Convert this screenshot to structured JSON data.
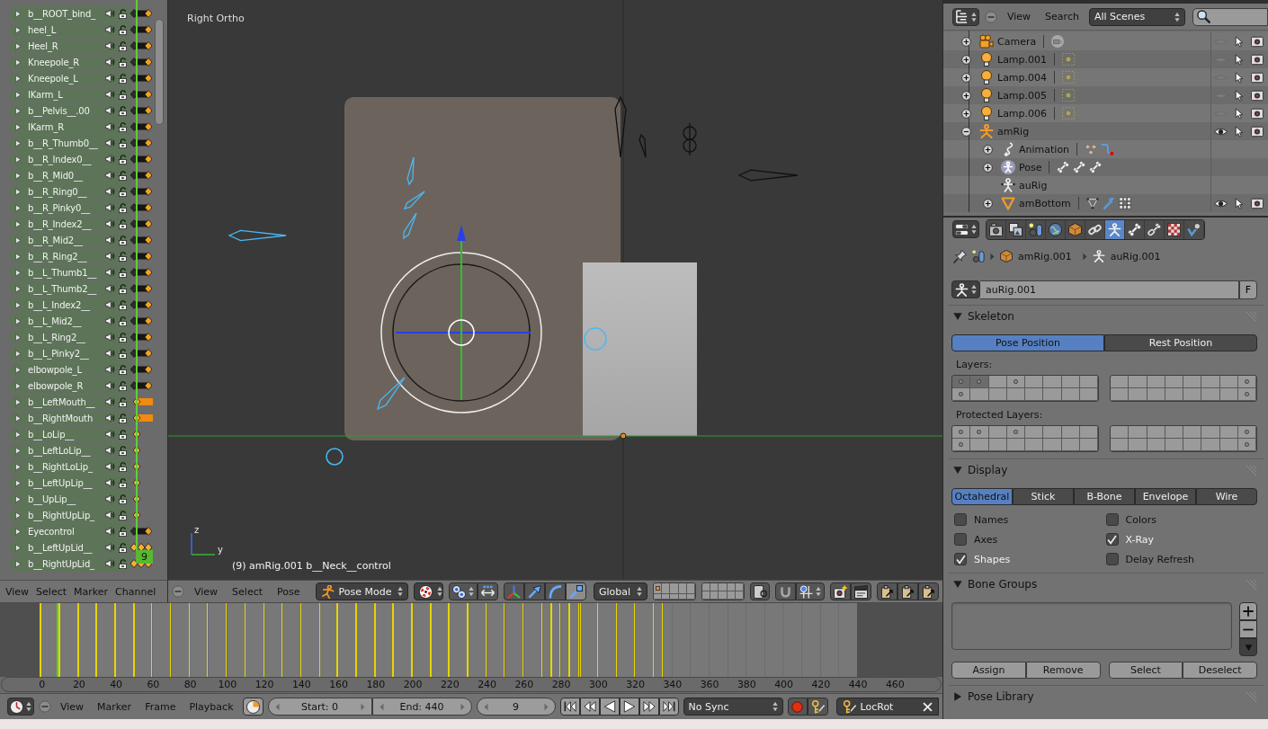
{
  "dopesheet": {
    "channels": [
      {
        "name": "b__ROOT_bind_",
        "kind": "hold"
      },
      {
        "name": "heel_L",
        "kind": "hold"
      },
      {
        "name": "Heel_R",
        "kind": "hold"
      },
      {
        "name": "Kneepole_R",
        "kind": "hold"
      },
      {
        "name": "Kneepole_L",
        "kind": "hold"
      },
      {
        "name": "IKarm_L",
        "kind": "hold"
      },
      {
        "name": "b__Pelvis__.00",
        "kind": "hold"
      },
      {
        "name": "IKarm_R",
        "kind": "hold"
      },
      {
        "name": "b__R_Thumb0__",
        "kind": "hold"
      },
      {
        "name": "b__R_Index0__",
        "kind": "hold"
      },
      {
        "name": "b__R_Mid0__",
        "kind": "hold"
      },
      {
        "name": "b__R_Ring0__",
        "kind": "hold"
      },
      {
        "name": "b__R_Pinky0__",
        "kind": "hold"
      },
      {
        "name": "b__R_Index2__",
        "kind": "hold"
      },
      {
        "name": "b__R_Mid2__",
        "kind": "hold"
      },
      {
        "name": "b__R_Ring2__",
        "kind": "hold"
      },
      {
        "name": "b__L_Thumb1__",
        "kind": "hold"
      },
      {
        "name": "b__L_Thumb2__",
        "kind": "hold"
      },
      {
        "name": "b__L_Index2__",
        "kind": "hold"
      },
      {
        "name": "b__L_Mid2__",
        "kind": "hold"
      },
      {
        "name": "b__L_Ring2__",
        "kind": "hold"
      },
      {
        "name": "b__L_Pinky2__",
        "kind": "hold"
      },
      {
        "name": "elbowpole_L",
        "kind": "hold"
      },
      {
        "name": "elbowpole_R",
        "kind": "hold"
      },
      {
        "name": "b__LeftMouth__",
        "kind": "orange_bar"
      },
      {
        "name": "b__RightMouth",
        "kind": "orange_bar"
      },
      {
        "name": "b__LoLip__",
        "kind": "diamond"
      },
      {
        "name": "b__LeftLoLip__",
        "kind": "diamond"
      },
      {
        "name": "b__RightLoLip_",
        "kind": "diamond"
      },
      {
        "name": "b__LeftUpLip__",
        "kind": "diamond"
      },
      {
        "name": "b__UpLip__",
        "kind": "diamond"
      },
      {
        "name": "b__RightUpLip_",
        "kind": "diamond"
      },
      {
        "name": "Eyecontrol",
        "kind": "hold"
      },
      {
        "name": "b__LeftUpLid__",
        "kind": "diamonds"
      },
      {
        "name": "b__RightUpLid_",
        "kind": "diamonds"
      }
    ],
    "current_frame": "9",
    "menus": [
      "View",
      "Select",
      "Marker",
      "Channel"
    ]
  },
  "viewport": {
    "view_name": "Right Ortho",
    "info": "(9) amRig.001 b__Neck__control",
    "axis_labels": {
      "vertical": "z",
      "horizontal": "y"
    },
    "header": {
      "menus": [
        "View",
        "Select",
        "Pose"
      ],
      "mode": "Pose Mode",
      "orientation": "Global",
      "transform_tools": [
        {
          "kind": "translate",
          "selected": false
        },
        {
          "kind": "rotate",
          "selected": false
        },
        {
          "kind": "scale",
          "selected": true
        }
      ],
      "scene_layers": [
        {
          "selected": false,
          "used": true
        },
        {
          "selected": false,
          "used": false
        },
        {
          "selected": false,
          "used": false
        },
        {
          "selected": false,
          "used": false
        },
        {
          "selected": false,
          "used": false
        },
        {
          "selected": false,
          "used": false
        },
        {
          "selected": false,
          "used": false
        },
        {
          "selected": false,
          "used": false
        },
        {
          "selected": false,
          "used": false
        },
        {
          "selected": false,
          "used": false
        },
        {
          "selected": false,
          "used": false
        },
        {
          "selected": false,
          "used": false
        },
        {
          "selected": false,
          "used": false
        },
        {
          "selected": false,
          "used": false
        },
        {
          "selected": false,
          "used": false
        },
        {
          "selected": false,
          "used": false
        },
        {
          "selected": false,
          "used": false
        },
        {
          "selected": false,
          "used": false
        },
        {
          "selected": false,
          "used": false
        },
        {
          "selected": false,
          "used": false
        }
      ]
    }
  },
  "timeline": {
    "range_start": {
      "level": 0.043
    },
    "range_end": {
      "level": 0.909
    },
    "keyframes": [
      {
        "level": 0.043
      },
      {
        "level": 0.063
      },
      {
        "level": 0.083
      },
      {
        "level": 0.102
      },
      {
        "level": 0.122
      },
      {
        "level": 0.142
      },
      {
        "level": 0.161
      },
      {
        "level": 0.181
      },
      {
        "level": 0.201
      },
      {
        "level": 0.22
      },
      {
        "level": 0.24
      },
      {
        "level": 0.26
      },
      {
        "level": 0.28
      },
      {
        "level": 0.299
      },
      {
        "level": 0.319
      },
      {
        "level": 0.339
      },
      {
        "level": 0.358
      },
      {
        "level": 0.378
      },
      {
        "level": 0.398
      },
      {
        "level": 0.417
      },
      {
        "level": 0.437
      },
      {
        "level": 0.457
      },
      {
        "level": 0.476
      },
      {
        "level": 0.496
      },
      {
        "level": 0.516
      },
      {
        "level": 0.535
      },
      {
        "level": 0.555
      },
      {
        "level": 0.575
      },
      {
        "level": 0.585
      },
      {
        "level": 0.594
      },
      {
        "level": 0.604
      },
      {
        "level": 0.614
      },
      {
        "level": 0.616
      },
      {
        "level": 0.634
      },
      {
        "level": 0.654
      },
      {
        "level": 0.673
      },
      {
        "level": 0.693
      },
      {
        "level": 0.703
      }
    ],
    "playhead": {
      "level": 0.061
    },
    "frame_labels": [
      "0",
      "20",
      "40",
      "60",
      "80",
      "100",
      "120",
      "140",
      "160",
      "180",
      "200",
      "220",
      "240",
      "260",
      "280",
      "300",
      "320",
      "340",
      "360",
      "380",
      "400",
      "420",
      "440",
      "460"
    ],
    "header": {
      "menus": [
        "View",
        "Marker",
        "Frame",
        "Playback"
      ],
      "start": "Start: 0",
      "end": "End: 440",
      "frame": "9",
      "sync": "No Sync",
      "keying_set": "LocRot"
    }
  },
  "outliner": {
    "menus": [
      "View",
      "Search"
    ],
    "scene_filter": "All Scenes",
    "items": [
      {
        "name": "Camera",
        "kind": "camera",
        "expanded": false,
        "visible": false
      },
      {
        "name": "Lamp.001",
        "kind": "lamp",
        "expanded": false,
        "visible": false
      },
      {
        "name": "Lamp.004",
        "kind": "lamp",
        "expanded": false,
        "visible": false
      },
      {
        "name": "Lamp.005",
        "kind": "lamp",
        "expanded": false,
        "visible": false
      },
      {
        "name": "Lamp.006",
        "kind": "lamp",
        "expanded": false,
        "visible": false
      },
      {
        "name": "amRig",
        "kind": "armature",
        "expanded": true,
        "visible": true,
        "children": [
          {
            "name": "Animation",
            "kind": "animation",
            "expanded": false
          },
          {
            "name": "Pose",
            "kind": "pose",
            "expanded": false
          },
          {
            "name": "auRig",
            "kind": "armature_data"
          },
          {
            "name": "amBottom",
            "kind": "mesh",
            "expanded": false,
            "visible": true
          }
        ]
      }
    ]
  },
  "properties": {
    "tabs": [
      {
        "kind": "render",
        "selected": false
      },
      {
        "kind": "render_layers",
        "selected": false
      },
      {
        "kind": "scene",
        "selected": false
      },
      {
        "kind": "world",
        "selected": false
      },
      {
        "kind": "object",
        "selected": false
      },
      {
        "kind": "constraints",
        "selected": false
      },
      {
        "kind": "data",
        "selected": true
      },
      {
        "kind": "bone",
        "selected": false
      },
      {
        "kind": "bone_constraints",
        "selected": false
      },
      {
        "kind": "texture",
        "selected": false
      },
      {
        "kind": "physics",
        "selected": false
      }
    ],
    "path": [
      {
        "kind": "object",
        "label": "amRig.001"
      },
      {
        "kind": "armature",
        "label": "auRig.001"
      }
    ],
    "datablock": {
      "name": "auRig.001",
      "fake_user": "F"
    },
    "skeleton": {
      "title": "Skeleton",
      "expanded": true,
      "positions": [
        {
          "label": "Pose Position",
          "selected": true
        },
        {
          "label": "Rest Position",
          "selected": false
        }
      ],
      "layers_label": "Layers:",
      "layers": [
        {
          "selected": true,
          "used": true
        },
        {
          "selected": true,
          "used": true
        },
        {
          "selected": false,
          "used": false
        },
        {
          "selected": false,
          "used": true
        },
        {
          "selected": false,
          "used": false
        },
        {
          "selected": false,
          "used": false
        },
        {
          "selected": false,
          "used": false
        },
        {
          "selected": false,
          "used": false
        },
        {
          "selected": false,
          "used": false
        },
        {
          "selected": false,
          "used": false
        },
        {
          "selected": false,
          "used": false
        },
        {
          "selected": false,
          "used": false
        },
        {
          "selected": false,
          "used": false
        },
        {
          "selected": false,
          "used": false
        },
        {
          "selected": false,
          "used": false
        },
        {
          "selected": false,
          "used": true
        },
        {
          "selected": false,
          "used": true
        },
        {
          "selected": false,
          "used": false
        },
        {
          "selected": false,
          "used": false
        },
        {
          "selected": false,
          "used": false
        },
        {
          "selected": false,
          "used": false
        },
        {
          "selected": false,
          "used": false
        },
        {
          "selected": false,
          "used": false
        },
        {
          "selected": false,
          "used": false
        },
        {
          "selected": false,
          "used": false
        },
        {
          "selected": false,
          "used": false
        },
        {
          "selected": false,
          "used": false
        },
        {
          "selected": false,
          "used": false
        },
        {
          "selected": false,
          "used": false
        },
        {
          "selected": false,
          "used": false
        },
        {
          "selected": false,
          "used": false
        },
        {
          "selected": false,
          "used": true
        }
      ],
      "protected_label": "Protected Layers:",
      "protected_layers": [
        {
          "selected": false,
          "used": true
        },
        {
          "selected": false,
          "used": true
        },
        {
          "selected": false,
          "used": false
        },
        {
          "selected": false,
          "used": true
        },
        {
          "selected": false,
          "used": false
        },
        {
          "selected": false,
          "used": false
        },
        {
          "selected": false,
          "used": false
        },
        {
          "selected": false,
          "used": false
        },
        {
          "selected": false,
          "used": false
        },
        {
          "selected": false,
          "used": false
        },
        {
          "selected": false,
          "used": false
        },
        {
          "selected": false,
          "used": false
        },
        {
          "selected": false,
          "used": false
        },
        {
          "selected": false,
          "used": false
        },
        {
          "selected": false,
          "used": false
        },
        {
          "selected": false,
          "used": true
        },
        {
          "selected": false,
          "used": true
        },
        {
          "selected": false,
          "used": false
        },
        {
          "selected": false,
          "used": false
        },
        {
          "selected": false,
          "used": false
        },
        {
          "selected": false,
          "used": false
        },
        {
          "selected": false,
          "used": false
        },
        {
          "selected": false,
          "used": false
        },
        {
          "selected": false,
          "used": false
        },
        {
          "selected": false,
          "used": false
        },
        {
          "selected": false,
          "used": false
        },
        {
          "selected": false,
          "used": false
        },
        {
          "selected": false,
          "used": false
        },
        {
          "selected": false,
          "used": false
        },
        {
          "selected": false,
          "used": false
        },
        {
          "selected": false,
          "used": false
        },
        {
          "selected": false,
          "used": true
        }
      ]
    },
    "display": {
      "title": "Display",
      "expanded": true,
      "draw_types": [
        {
          "label": "Octahedral",
          "selected": true
        },
        {
          "label": "Stick",
          "selected": false
        },
        {
          "label": "B-Bone",
          "selected": false
        },
        {
          "label": "Envelope",
          "selected": false
        },
        {
          "label": "Wire",
          "selected": false
        }
      ],
      "options": [
        {
          "label": "Names",
          "checked": false
        },
        {
          "label": "Colors",
          "checked": false
        },
        {
          "label": "Axes",
          "checked": false
        },
        {
          "label": "X-Ray",
          "checked": true
        },
        {
          "label": "Shapes",
          "checked": true
        },
        {
          "label": "Delay Refresh",
          "checked": false
        }
      ]
    },
    "bone_groups": {
      "title": "Bone Groups",
      "expanded": true,
      "buttons": [
        "Assign",
        "Remove",
        "Select",
        "Deselect"
      ]
    },
    "pose_library": {
      "title": "Pose Library",
      "expanded": false
    }
  }
}
